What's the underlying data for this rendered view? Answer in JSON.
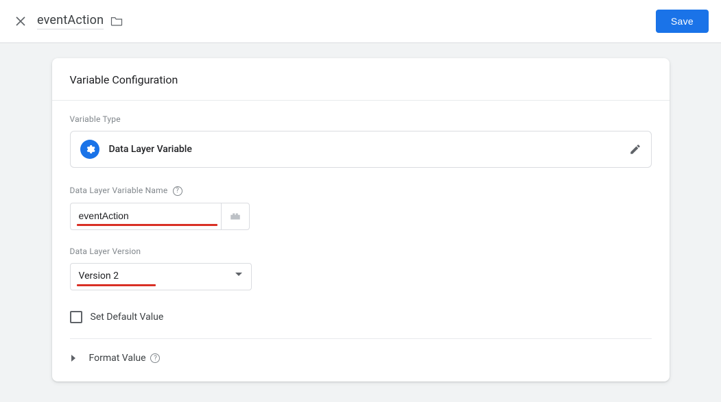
{
  "header": {
    "title_value": "eventAction",
    "save_label": "Save"
  },
  "card": {
    "title": "Variable Configuration",
    "variable_type_label": "Variable Type",
    "variable_type_name": "Data Layer Variable",
    "dlv_name_label": "Data Layer Variable Name",
    "dlv_name_value": "eventAction",
    "dlv_version_label": "Data Layer Version",
    "dlv_version_value": "Version 2",
    "set_default_label": "Set Default Value",
    "format_value_label": "Format Value"
  }
}
